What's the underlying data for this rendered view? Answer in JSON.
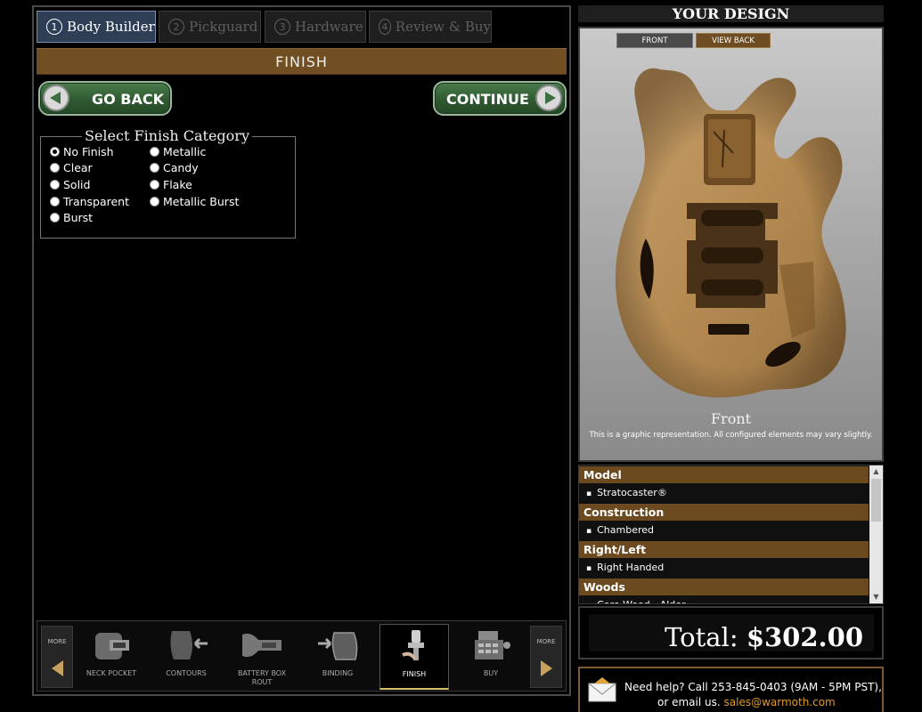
{
  "steps": [
    {
      "num": "1",
      "label": "Body Builder",
      "active": true
    },
    {
      "num": "2",
      "label": "Pickguard",
      "active": false
    },
    {
      "num": "3",
      "label": "Hardware",
      "active": false
    },
    {
      "num": "4",
      "label": "Review & Buy",
      "active": false
    }
  ],
  "section_title": "FINISH",
  "nav": {
    "back_label": "GO BACK",
    "continue_label": "CONTINUE"
  },
  "finish_category": {
    "legend": "Select Finish Category",
    "selected": "No Finish",
    "options": [
      "No Finish",
      "Clear",
      "Solid",
      "Transparent",
      "Burst",
      "Metallic",
      "Candy",
      "Flake",
      "Metallic Burst"
    ]
  },
  "carousel": {
    "more_label": "MORE",
    "items": [
      {
        "label": "NECK POCKET",
        "current": false
      },
      {
        "label": "CONTOURS",
        "current": false
      },
      {
        "label": "BATTERY BOX ROUT",
        "current": false
      },
      {
        "label": "BINDING",
        "current": false
      },
      {
        "label": "FINISH",
        "current": true
      },
      {
        "label": "BUY",
        "current": false
      }
    ]
  },
  "design": {
    "title": "YOUR DESIGN",
    "tab_front": "FRONT",
    "tab_view_back": "VIEW BACK",
    "view_caption": "Front",
    "note": "This is a graphic representation. All configured elements may vary slightly."
  },
  "specs": [
    {
      "heading": "Model",
      "value": "Stratocaster®"
    },
    {
      "heading": "Construction",
      "value": "Chambered"
    },
    {
      "heading": "Right/Left",
      "value": "Right Handed"
    },
    {
      "heading": "Woods",
      "value": "Core Wood - Alder"
    }
  ],
  "total": {
    "label": "Total:",
    "amount": "$302.00"
  },
  "help": {
    "line1": "Need help? Call 253-845-0403 (9AM - 5PM PST),",
    "line2_prefix": "or email us.",
    "email": "sales@warmoth.com"
  },
  "colors": {
    "accent_brown": "#714f23",
    "button_green": "#2f5a31",
    "email_orange": "#e69a1f"
  }
}
